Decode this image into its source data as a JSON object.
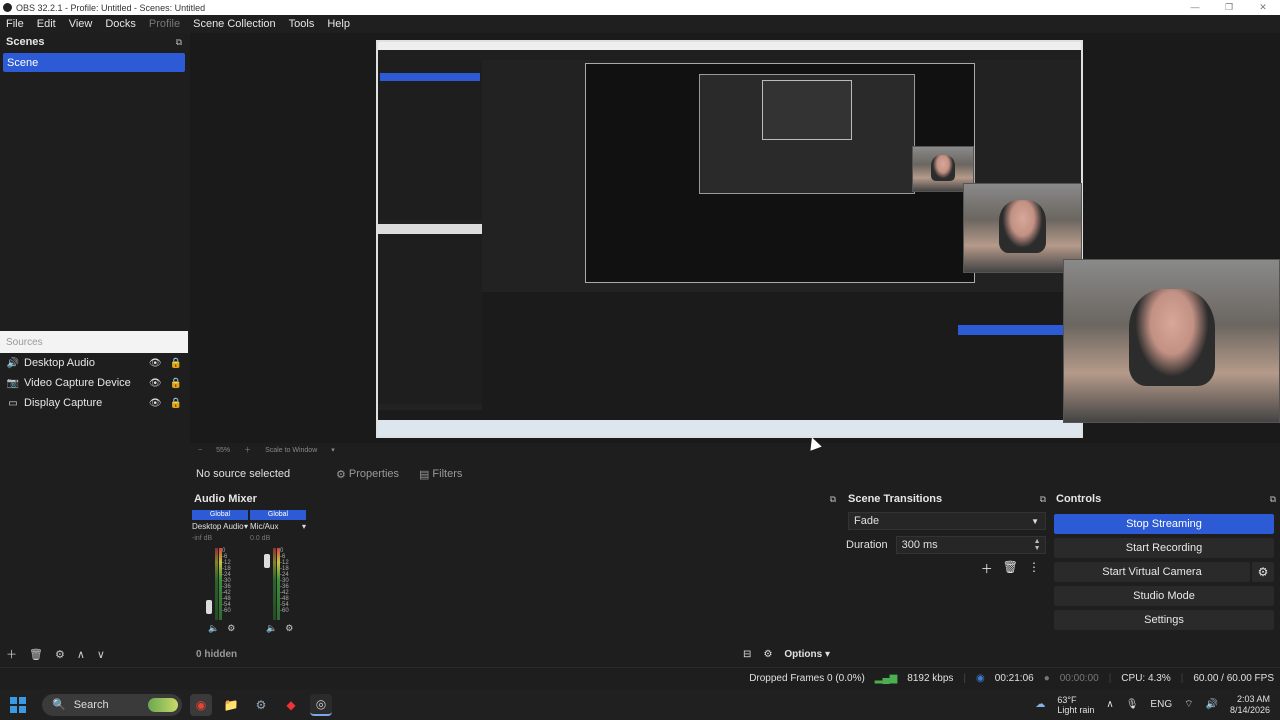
{
  "window": {
    "title": "OBS 32.2.1 - Profile: Untitled - Scenes: Untitled",
    "min": "—",
    "max": "❐",
    "close": "✕"
  },
  "menu": [
    "File",
    "Edit",
    "View",
    "Docks",
    "Profile",
    "Scene Collection",
    "Tools",
    "Help"
  ],
  "scenes": {
    "title": "Scenes",
    "items": [
      "Scene"
    ]
  },
  "sources": {
    "title": "Sources",
    "items": [
      {
        "name": "Desktop Audio",
        "icon": "speaker-icon"
      },
      {
        "name": "Video Capture Device",
        "icon": "camera-icon"
      },
      {
        "name": "Display Capture",
        "icon": "monitor-icon"
      }
    ]
  },
  "preview": {
    "zoom": "55%",
    "scale_mode": "Scale to Window"
  },
  "source_toolbar": {
    "no_selection": "No source selected",
    "properties": "Properties",
    "filters": "Filters"
  },
  "audio_mixer": {
    "title": "Audio Mixer",
    "channels": [
      {
        "badge": "Global",
        "name": "Desktop Audio",
        "level": "-inf dB",
        "fader": 0.1
      },
      {
        "badge": "Global",
        "name": "Mic/Aux",
        "level": "0.0 dB",
        "fader": 0.9
      }
    ],
    "scale": [
      "0",
      "-6",
      "-12",
      "-18",
      "-24",
      "-30",
      "-36",
      "-42",
      "-48",
      "-54",
      "-60"
    ],
    "hidden_count": "0 hidden",
    "options": "Options"
  },
  "scene_transitions": {
    "title": "Scene Transitions",
    "transition": "Fade",
    "duration_label": "Duration",
    "duration_value": "300 ms"
  },
  "controls": {
    "title": "Controls",
    "stop_streaming": "Stop Streaming",
    "start_recording": "Start Recording",
    "start_virtual_camera": "Start Virtual Camera",
    "studio_mode": "Studio Mode",
    "settings": "Settings"
  },
  "status": {
    "dropped_frames": "Dropped Frames 0 (0.0%)",
    "bitrate": "8192 kbps",
    "stream_time": "00:21:06",
    "rec_time": "00:00:00",
    "cpu": "CPU: 4.3%",
    "fps": "60.00 / 60.00 FPS"
  },
  "taskbar": {
    "search": "Search",
    "weather_temp": "63°F",
    "weather_desc": "Light rain",
    "lang": "ENG",
    "time": "2:03 AM",
    "date": "8/14/2026"
  },
  "colors": {
    "accent": "#2c5bd5",
    "background": "#1e1e1e"
  }
}
